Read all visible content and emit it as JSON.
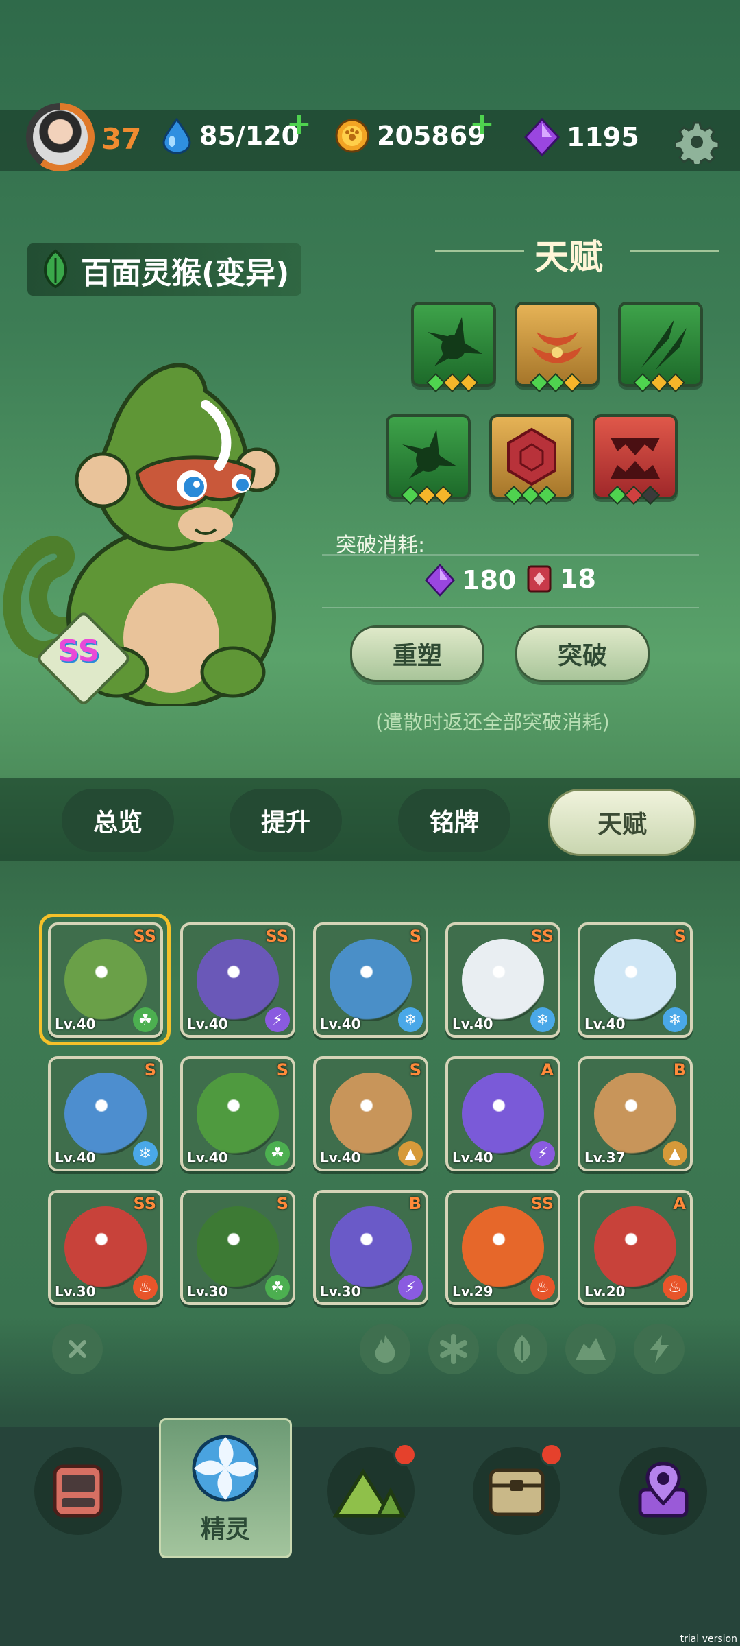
{
  "top_bar": {
    "level": "37",
    "stamina": "85/120",
    "coins": "205869",
    "gems": "1195"
  },
  "pet": {
    "name": "百面灵猴(变异)",
    "rank": "SS"
  },
  "talent": {
    "title": "天赋",
    "cost_label": "突破消耗:",
    "cost_gems": "180",
    "cost_item": "18",
    "reshape_button": "重塑",
    "breakthrough_button": "突破",
    "note": "(遣散时返还全部突破消耗)"
  },
  "tabs": [
    "总览",
    "提升",
    "铭牌",
    "天赋"
  ],
  "pets": [
    {
      "lv": "Lv.40",
      "rank": "SS",
      "element": "leaf",
      "color": "#6aa048"
    },
    {
      "lv": "Lv.40",
      "rank": "SS",
      "element": "thunder",
      "color": "#6a58b8"
    },
    {
      "lv": "Lv.40",
      "rank": "S",
      "element": "ice",
      "color": "#4a8fc8"
    },
    {
      "lv": "Lv.40",
      "rank": "SS",
      "element": "ice",
      "color": "#e9eef2"
    },
    {
      "lv": "Lv.40",
      "rank": "S",
      "element": "ice",
      "color": "#cfe6f5"
    },
    {
      "lv": "Lv.40",
      "rank": "S",
      "element": "ice",
      "color": "#4d8ecf"
    },
    {
      "lv": "Lv.40",
      "rank": "S",
      "element": "leaf",
      "color": "#4f9a3f"
    },
    {
      "lv": "Lv.40",
      "rank": "S",
      "element": "earth",
      "color": "#c8955a"
    },
    {
      "lv": "Lv.40",
      "rank": "A",
      "element": "thunder",
      "color": "#7a5ad8"
    },
    {
      "lv": "Lv.37",
      "rank": "B",
      "element": "earth",
      "color": "#c8955a"
    },
    {
      "lv": "Lv.30",
      "rank": "SS",
      "element": "fire",
      "color": "#c8423a"
    },
    {
      "lv": "Lv.30",
      "rank": "S",
      "element": "leaf",
      "color": "#3d7a34"
    },
    {
      "lv": "Lv.30",
      "rank": "B",
      "element": "thunder",
      "color": "#6a5ac8"
    },
    {
      "lv": "Lv.29",
      "rank": "SS",
      "element": "fire",
      "color": "#e6672a"
    },
    {
      "lv": "Lv.20",
      "rank": "A",
      "element": "fire",
      "color": "#c8423a"
    }
  ],
  "element_colors": {
    "leaf": "#4caf50",
    "thunder": "#8a5be0",
    "ice": "#4aa8e8",
    "earth": "#d69a3a",
    "fire": "#e8552a"
  },
  "bottom_nav": {
    "active_label": "精灵"
  },
  "watermark": "trial version"
}
